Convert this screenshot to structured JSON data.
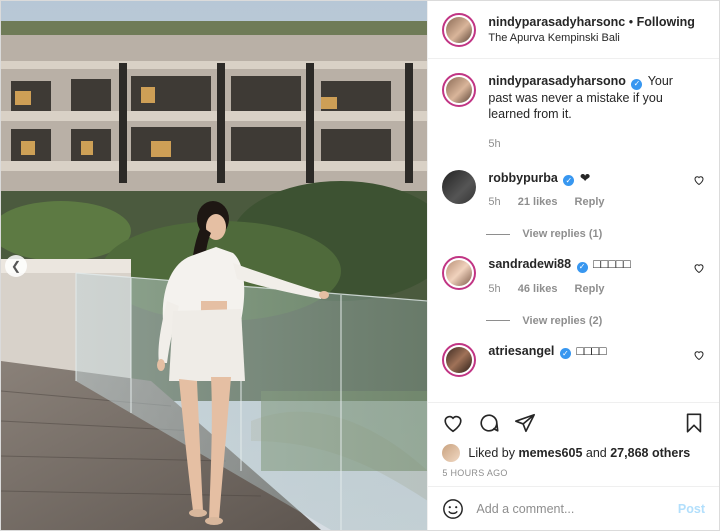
{
  "post": {
    "author": "nindyparasadyharsonc",
    "follow_separator": "•",
    "follow_status": "Following",
    "location": "The Apurva Kempinski Bali"
  },
  "caption": {
    "username": "nindyparasadyharsono",
    "text": "Your past was never a mistake if you learned from it.",
    "time": "5h"
  },
  "comments": [
    {
      "username": "robbypurba",
      "text": "❤",
      "time": "5h",
      "likes": "21 likes",
      "reply": "Reply",
      "view_replies": "View replies (1)"
    },
    {
      "username": "sandradewi88",
      "text": "□□□□□",
      "time": "5h",
      "likes": "46 likes",
      "reply": "Reply",
      "view_replies": "View replies (2)"
    },
    {
      "username": "atriesangel",
      "text": "□□□□"
    }
  ],
  "likes": {
    "prefix": "Liked by",
    "user": "memes605",
    "middle": "and",
    "count": "27,868 others"
  },
  "timestamp": "5 HOURS AGO",
  "add_comment": {
    "placeholder": "Add a comment...",
    "post_label": "Post"
  },
  "icons": {
    "like": "heart-icon",
    "comment": "comment-icon",
    "share": "share-icon",
    "save": "bookmark-icon",
    "emoji": "smile-icon",
    "prev": "chevron-left-icon"
  },
  "colors": {
    "verified": "#3897f0",
    "story_ring": "#c13584",
    "post_disabled": "#b2dffc"
  }
}
